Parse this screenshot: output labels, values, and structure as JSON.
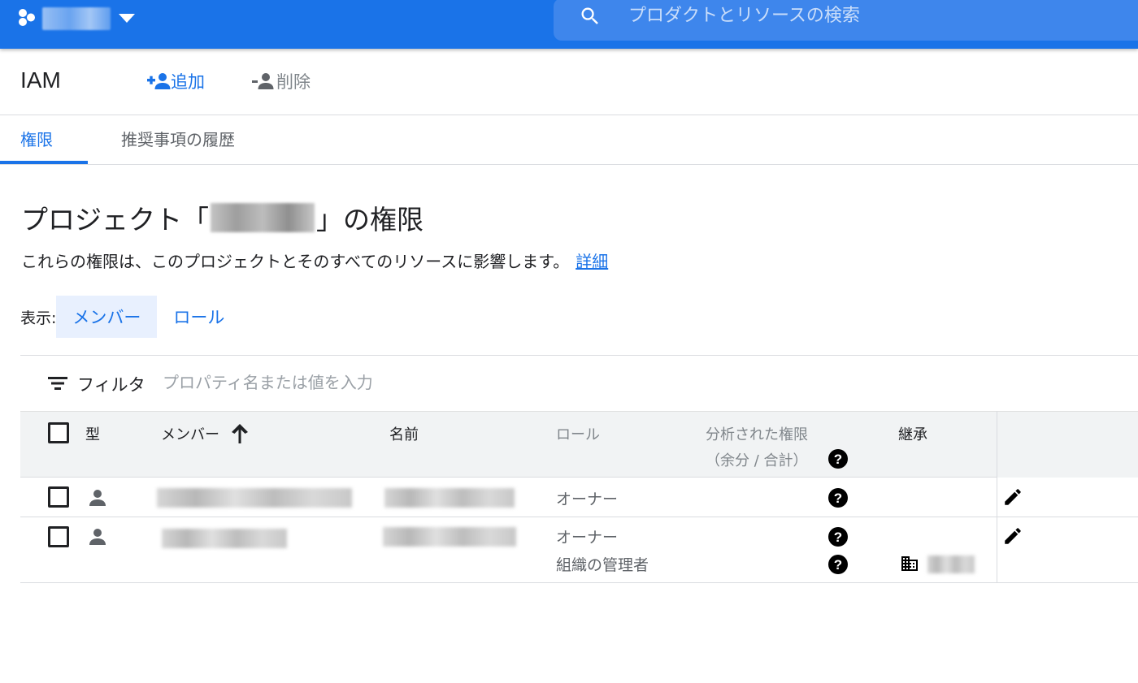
{
  "topbar": {
    "search_placeholder": "プロダクトとリソースの検索",
    "colors": {
      "bar": "#1a73e8",
      "search_box": "#3e86ec"
    }
  },
  "header": {
    "title": "IAM",
    "add_label": "追加",
    "remove_label": "削除"
  },
  "tabs": [
    {
      "label": "権限",
      "active": true
    },
    {
      "label": "推奨事項の履歴",
      "active": false
    }
  ],
  "section": {
    "title_prefix": "プロジェクト「",
    "title_suffix": "」の権限",
    "description": "これらの権限は、このプロジェクトとそのすべてのリソースに影響します。",
    "details_link": "詳細"
  },
  "view": {
    "label": "表示:",
    "options": [
      {
        "label": "メンバー",
        "active": true
      },
      {
        "label": "ロール",
        "active": false
      }
    ]
  },
  "filter": {
    "label": "フィルタ",
    "placeholder": "プロパティ名または値を入力"
  },
  "table": {
    "columns": {
      "type": "型",
      "member": "メンバー",
      "name": "名前",
      "role": "ロール",
      "analyzed": "分析された権限",
      "analyzed_sub": "（余分 / 合計）",
      "inheritance": "継承"
    },
    "rows": [
      {
        "roles": [
          "オーナー"
        ]
      },
      {
        "roles": [
          "オーナー",
          "組織の管理者"
        ]
      }
    ]
  },
  "colors": {
    "accent": "#1a73e8",
    "text": "#202124",
    "muted": "#5f6368",
    "header_bg": "#f1f3f4"
  }
}
